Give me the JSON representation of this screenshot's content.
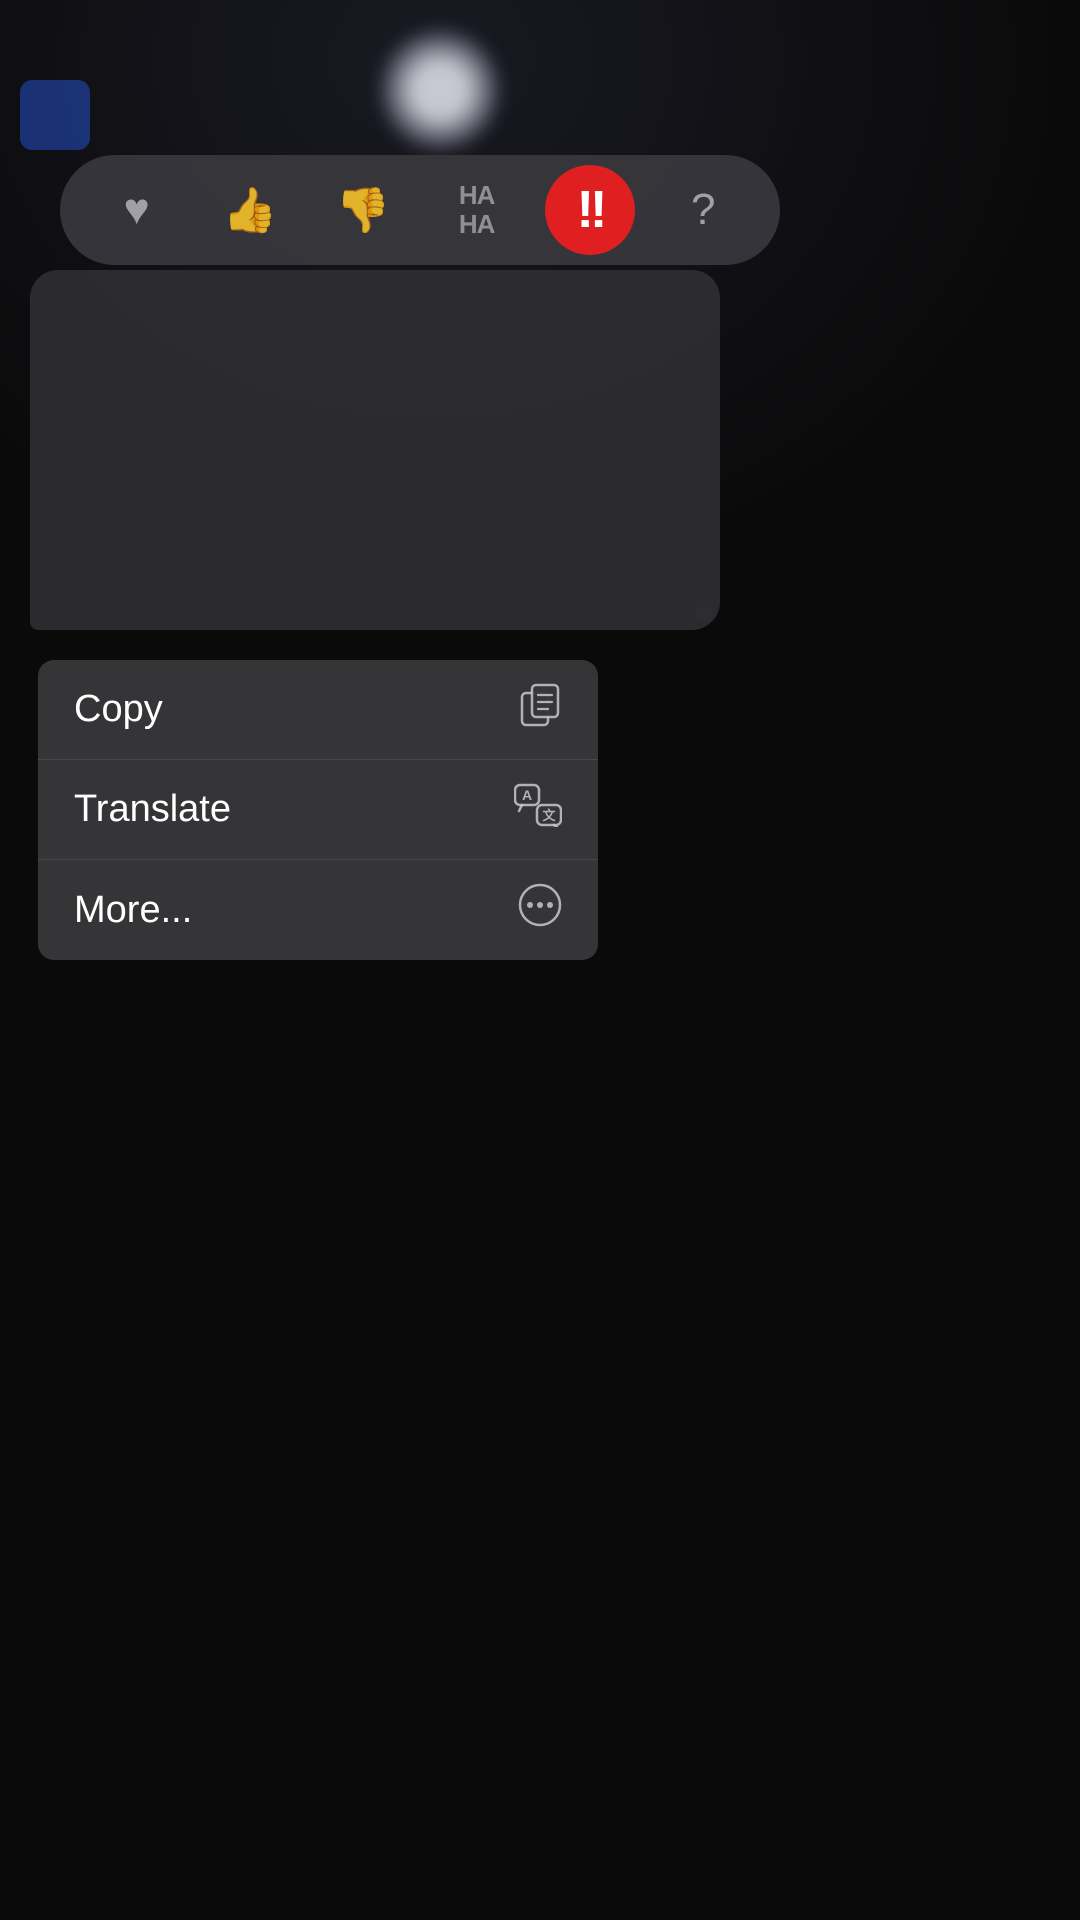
{
  "background": {
    "color": "#0a0a0a"
  },
  "reaction_bar": {
    "buttons": [
      {
        "id": "heart",
        "icon": "♥",
        "type": "heart",
        "active": false,
        "label": "Heart"
      },
      {
        "id": "thumbsup",
        "icon": "👍",
        "type": "thumbsup",
        "active": false,
        "label": "Like"
      },
      {
        "id": "thumbsdown",
        "icon": "👎",
        "type": "thumbsdown",
        "active": false,
        "label": "Dislike"
      },
      {
        "id": "haha",
        "icon": "HAHA",
        "type": "haha",
        "active": false,
        "label": "Haha"
      },
      {
        "id": "exclaim",
        "icon": "!!",
        "type": "exclaim",
        "active": true,
        "label": "Emphasize"
      },
      {
        "id": "question",
        "icon": "?",
        "type": "question",
        "active": false,
        "label": "Question"
      }
    ]
  },
  "context_menu": {
    "items": [
      {
        "id": "copy",
        "label": "Copy",
        "icon": "copy"
      },
      {
        "id": "translate",
        "label": "Translate",
        "icon": "translate"
      },
      {
        "id": "more",
        "label": "More...",
        "icon": "more"
      }
    ]
  }
}
